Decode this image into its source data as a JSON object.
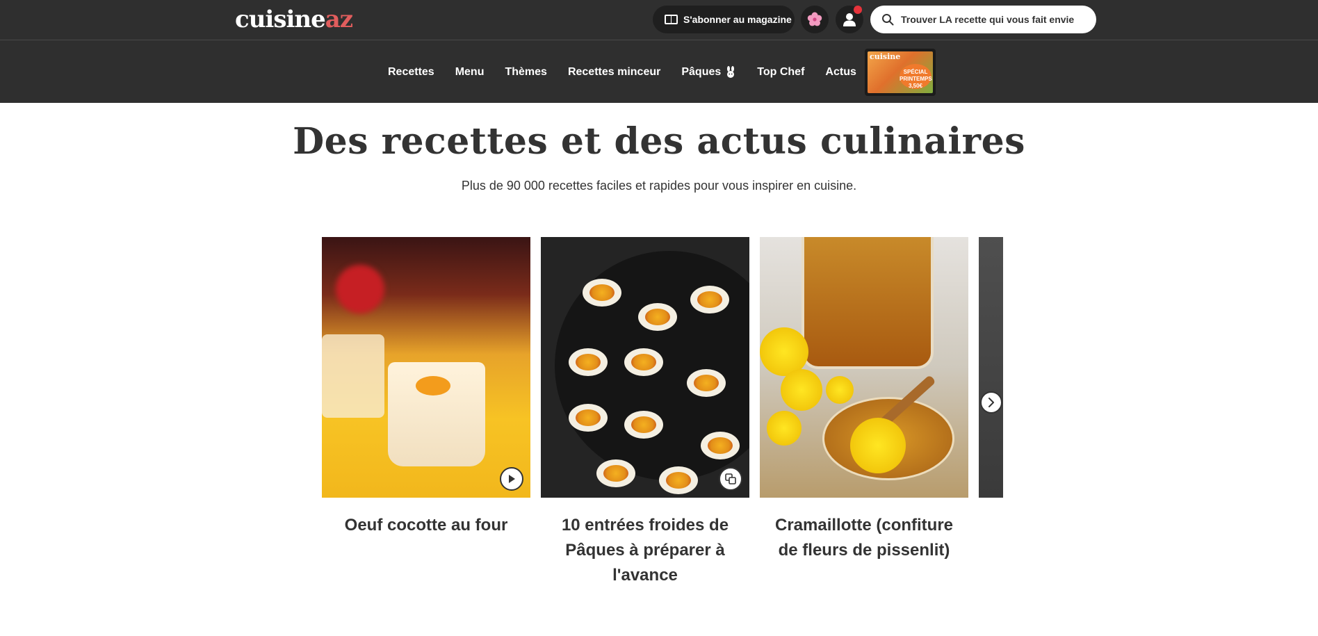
{
  "header": {
    "logo_main": "cuisine",
    "logo_accent": "az",
    "subscribe_label": "S'abonner au magazine",
    "search_placeholder": "Trouver LA recette qui vous fait envie"
  },
  "nav": {
    "items": [
      {
        "label": "Recettes"
      },
      {
        "label": "Menu"
      },
      {
        "label": "Thèmes"
      },
      {
        "label": "Recettes minceur"
      },
      {
        "label": "Pâques"
      },
      {
        "label": "Top Chef"
      },
      {
        "label": "Actus"
      }
    ]
  },
  "magazine_promo": {
    "title": "cuisine",
    "badge": "SPÉCIAL PRINTEMPS 3,50€"
  },
  "main": {
    "title": "Des recettes et des actus culinaires",
    "subtitle": "Plus de 90 000 recettes faciles et rapides pour vous inspirer en cuisine."
  },
  "cards": [
    {
      "title": "Oeuf cocotte au four",
      "badge_icon": "play-icon"
    },
    {
      "title": "10 entrées froides de Pâques à préparer à l'avance",
      "badge_icon": "gallery-icon"
    },
    {
      "title": "Cramaillotte (confiture de fleurs de pissenlit)",
      "badge_icon": ""
    },
    {
      "title": "",
      "badge_icon": ""
    }
  ],
  "colors": {
    "header_bg": "#2f2f2f",
    "logo_accent": "#e15d5d",
    "notification_dot": "#e6333b",
    "text": "#333333"
  }
}
